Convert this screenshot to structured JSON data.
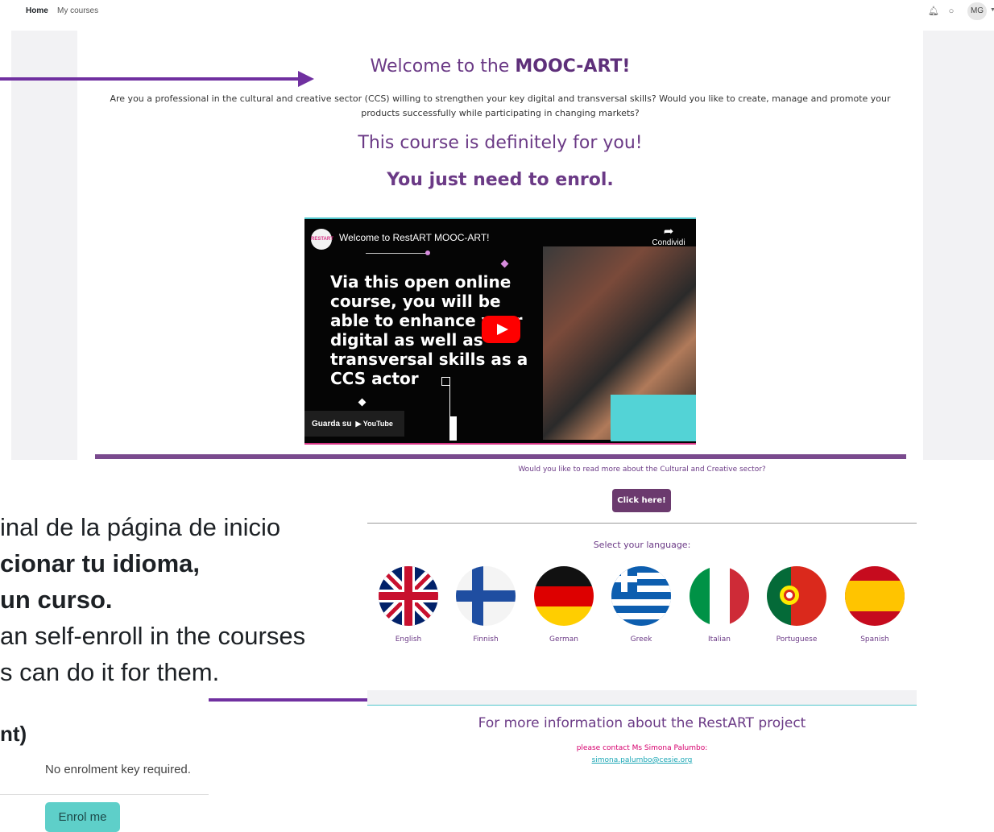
{
  "nav": {
    "home": "Home",
    "my_courses": "My courses",
    "avatar": "MG"
  },
  "welcome": {
    "prefix": "Welcome to the ",
    "highlight": "MOOC-ART!"
  },
  "intro": "Are you a professional in the cultural and creative sector (CCS) willing to strengthen your key digital and transversal skills? Would you like to create, manage and promote your products successfully while participating in changing markets?",
  "course_line": "This course is definitely for you!",
  "enrol_line": "You just need to enrol.",
  "video": {
    "logo": "RESTART",
    "title": "Welcome to RestART MOOC-ART!",
    "share": "Condividi",
    "text": "Via this open online course, you will be able to enhance your digital as well as transversal skills as a CCS actor",
    "watch": "Guarda su",
    "youtube": "YouTube"
  },
  "read_more": "Would you like to read more about the Cultural and Creative sector?",
  "click_here": "Click here!",
  "select_language": "Select your language:",
  "languages": [
    {
      "label": "English"
    },
    {
      "label": "Finnish"
    },
    {
      "label": "German"
    },
    {
      "label": "Greek"
    },
    {
      "label": "Italian"
    },
    {
      "label": "Portuguese"
    },
    {
      "label": "Spanish"
    }
  ],
  "slide": {
    "line1": "inal de la página de inicio",
    "line2": "cionar tu idioma,",
    "line3": " un curso.",
    "line4": "an self-enroll in the courses",
    "line5": "s can do it for them."
  },
  "enrol_panel": {
    "heading": "nt)",
    "no_key": "No enrolment key required.",
    "button": "Enrol me"
  },
  "more_info": "For more information about the RestART project",
  "contact": "please contact Ms Simona Palumbo:",
  "email": "simona.palumbo@cesie.org",
  "colors": {
    "brand_purple": "#6b3a86",
    "arrow_purple": "#7030a0",
    "teal": "#4fc6cc",
    "enrol_button": "#5ecfc9"
  }
}
